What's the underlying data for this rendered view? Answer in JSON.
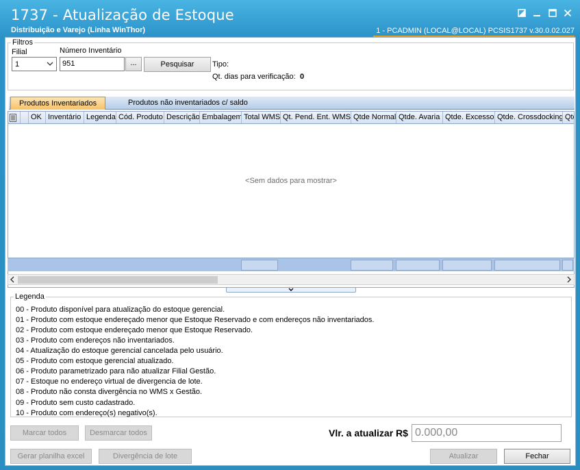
{
  "window": {
    "title": "1737 - Atualização de Estoque",
    "subtitle": "Distribuição e Varejo (Linha WinThor)",
    "status": "1 - PCADMIN (LOCAL@LOCAL)   PCSIS1737  v.30.0.02.027"
  },
  "filters": {
    "group_label": "Filtros",
    "filial_label": "Filial",
    "filial_value": "1",
    "inventario_label": "Número Inventário",
    "inventario_value": "951",
    "ellipsis_label": "...",
    "search_label": "Pesquisar",
    "tipo_label": "Tipo:",
    "dias_label": "Qt. dias para verificação:",
    "dias_value": "0"
  },
  "tabs": [
    {
      "label": "Produtos  Inventariados"
    },
    {
      "label": "Produtos não inventariados c/ saldo"
    }
  ],
  "grid": {
    "columns": [
      "OK",
      "Inventário",
      "Legenda",
      "Cód. Produto",
      "Descrição",
      "Embalagem",
      "Total WMS",
      "Qt. Pend. Ent. WMS",
      "Qtde Normal",
      "Qtde. Avaria",
      "Qtde. Excesso",
      "Qtde. Crossdocking",
      "Qtd"
    ],
    "empty_message": "<Sem dados para mostrar>"
  },
  "legend": {
    "title": "Legenda",
    "items": [
      "00 - Produto disponível para atualização do estoque gerencial.",
      "01 - Produto com estoque endereçado menor que Estoque Reservado e  com endereços não inventariados.",
      "02 - Produto com estoque endereçado menor que Estoque Reservado.",
      "03 - Produto com endereços não inventariados.",
      "04 - Atualização do estoque gerencial cancelada pelo usuário.",
      "05 - Produto com estoque gerencial atualizado.",
      "06 - Produto parametrizado para não atualizar Filial Gestão.",
      "07 - Estoque no endereço virtual de divergencia de lote.",
      "08 - Produto não consta divergência no WMS x Gestão.",
      "09 - Produto sem custo cadastrado.",
      "10 - Produto com endereço(s) negativo(s)."
    ]
  },
  "actions": {
    "marcar_todos": "Marcar todos",
    "desmarcar_todos": "Desmarcar todos",
    "vlr_label": "Vlr. a atualizar R$",
    "vlr_value": "0.000,00",
    "gerar_planilha": "Gerar planilha excel",
    "divergencia_lote": "Divergência de lote",
    "atualizar": "Atualizar",
    "fechar": "Fechar"
  }
}
